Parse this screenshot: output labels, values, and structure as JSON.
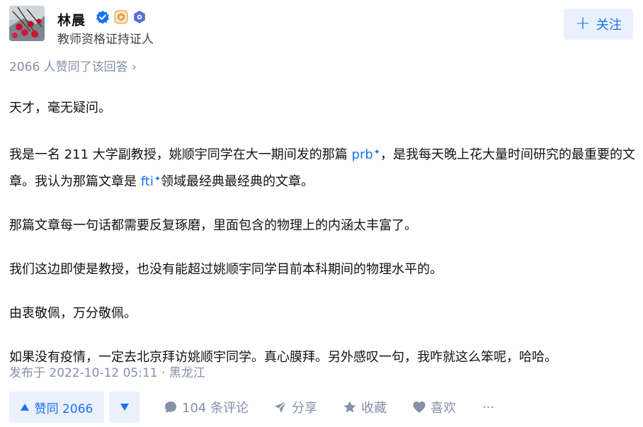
{
  "author": {
    "name": "林晨",
    "headline": "教师资格证持证人"
  },
  "follow_button": {
    "label": "关注"
  },
  "upvote_summary": "2066 人赞同了该回答 ›",
  "content": {
    "p1": "天才，毫无疑问。",
    "p2_a": "我是一名 211 大学副教授，姚顺宇同学在大一期间发的那篇 ",
    "p2_link1": "prb",
    "p2_b": "，是我每天晚上花大量时间研究的最重要的文章。我认为那篇文章是 ",
    "p2_link2": "fti",
    "p2_c": "领域最经典最经典的文章。",
    "p3": "那篇文章每一句话都需要反复琢磨，里面包含的物理上的内涵太丰富了。",
    "p4": "我们这边即使是教授，也没有能超过姚顺宇同学目前本科期间的物理水平的。",
    "p5": "由衷敬佩，万分敬佩。",
    "p6": "如果没有疫情，一定去北京拜访姚顺宇同学。真心膜拜。另外感叹一句，我咋就这么笨呢，哈哈。"
  },
  "meta": "发布于 2022-10-12 05:11 · 黑龙江",
  "actions": {
    "upvote_label": "赞同 2066",
    "comments": "104 条评论",
    "share": "分享",
    "favorite": "收藏",
    "like": "喜欢",
    "more": "···"
  },
  "colors": {
    "accent": "#1772f6",
    "accent_bg": "#eaf1fc",
    "muted": "#8590a6"
  }
}
